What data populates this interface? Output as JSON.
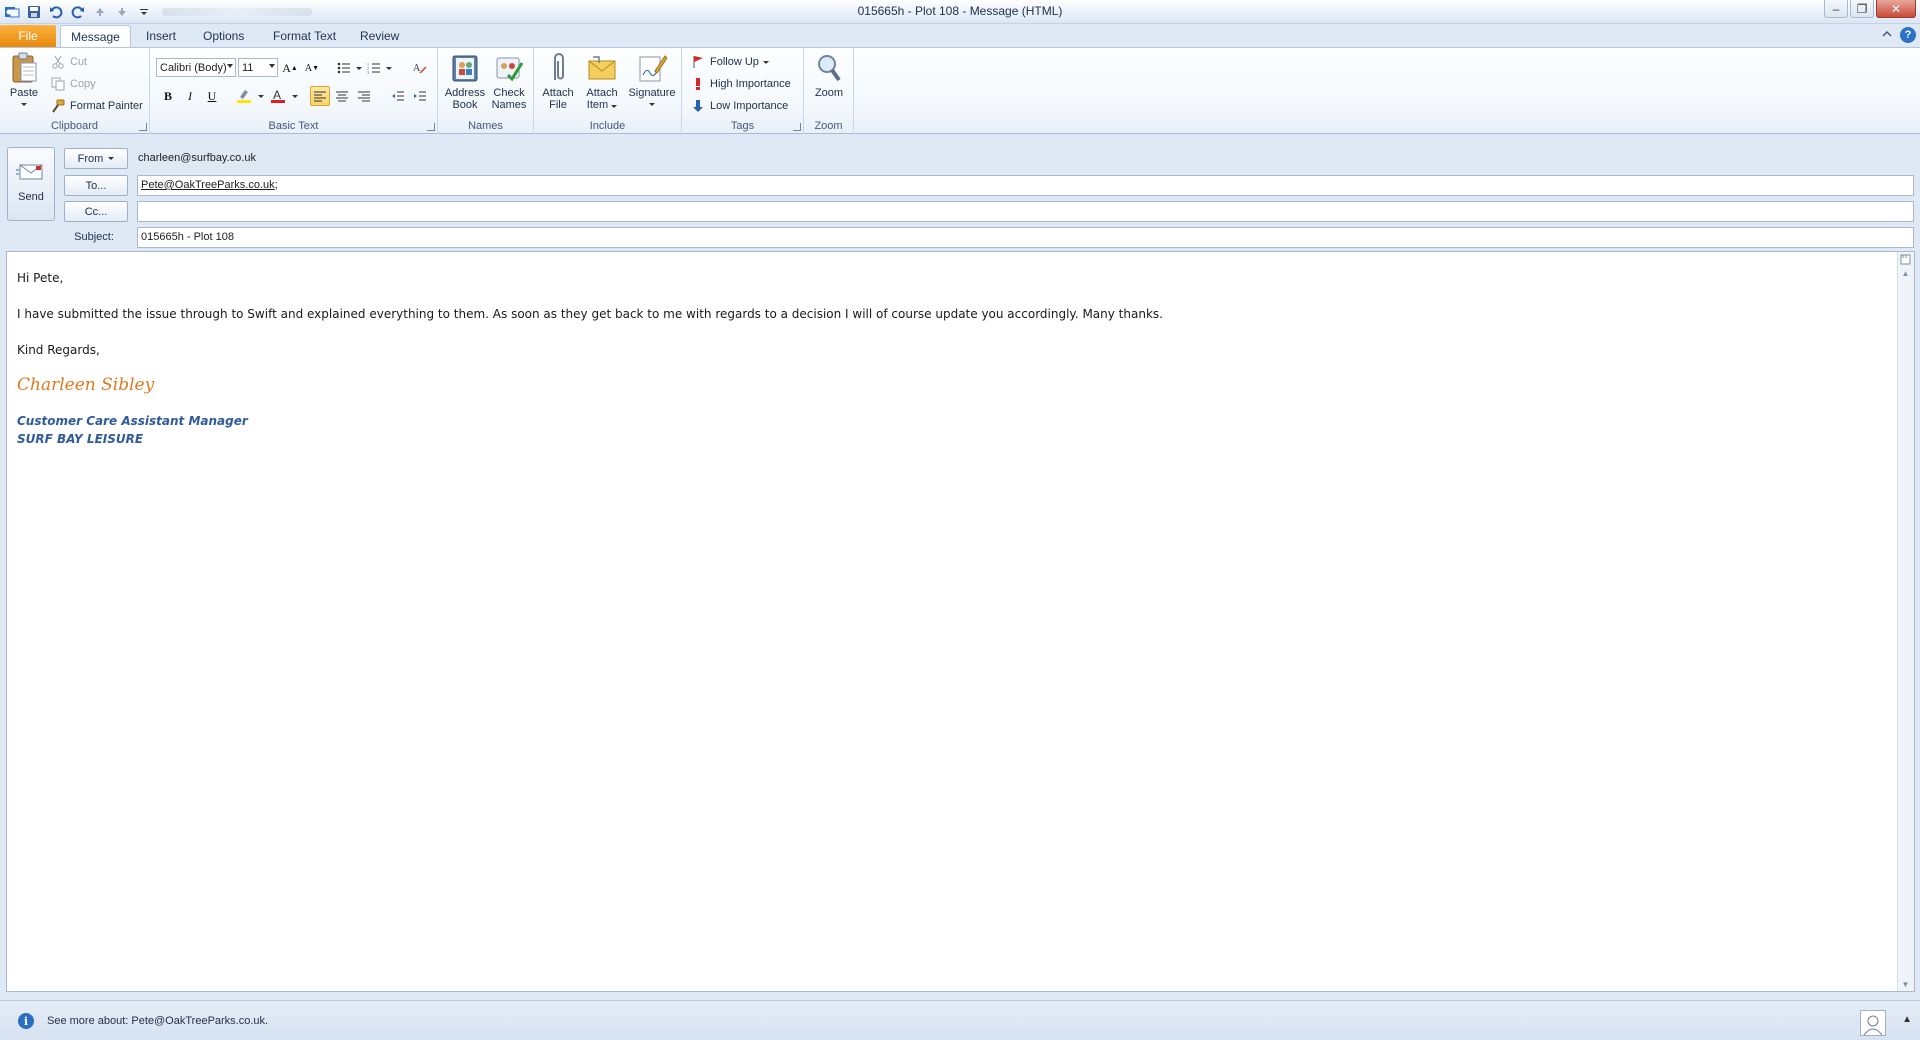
{
  "window": {
    "title": "015665h - Plot 108  -  Message (HTML)",
    "minimize": "–",
    "restore": "❐",
    "close": "✕"
  },
  "tabs": {
    "file": "File",
    "message": "Message",
    "insert": "Insert",
    "options": "Options",
    "format_text": "Format Text",
    "review": "Review"
  },
  "ribbon": {
    "clipboard": {
      "label": "Clipboard",
      "paste": "Paste",
      "cut": "Cut",
      "copy": "Copy",
      "format_painter": "Format Painter"
    },
    "basic_text": {
      "label": "Basic Text",
      "font": "Calibri (Body)",
      "size": "11",
      "bold": "B",
      "italic": "I",
      "underline": "U"
    },
    "names": {
      "label": "Names",
      "address_book_1": "Address",
      "address_book_2": "Book",
      "check_names_1": "Check",
      "check_names_2": "Names"
    },
    "include": {
      "label": "Include",
      "attach_file_1": "Attach",
      "attach_file_2": "File",
      "attach_item_1": "Attach",
      "attach_item_2": "Item",
      "signature": "Signature"
    },
    "tags": {
      "label": "Tags",
      "follow_up": "Follow Up",
      "high_importance": "High Importance",
      "low_importance": "Low Importance"
    },
    "zoom": {
      "label": "Zoom",
      "zoom": "Zoom"
    }
  },
  "header": {
    "send": "Send",
    "from_label": "From",
    "from_value": "charleen@surfbay.co.uk",
    "to_label": "To...",
    "to_value": "Pete@OakTreeParks.co.uk",
    "to_sep": ";",
    "cc_label": "Cc...",
    "cc_value": "",
    "subject_label": "Subject:",
    "subject_value": "015665h - Plot 108"
  },
  "body": {
    "greeting": "Hi Pete,",
    "paragraph": "I have submitted the issue through to Swift and explained everything to them.  As soon as they get back to me with regards to a decision I will of course update you accordingly.  Many thanks.",
    "closing": "Kind Regards,",
    "signature_name": "Charleen Sibley",
    "signature_title": "Customer Care Assistant Manager",
    "signature_company": "SURF BAY LEISURE"
  },
  "status": {
    "text": "See more about: Pete@OakTreeParks.co.uk."
  },
  "colors": {
    "file_tab": "#e98a0d",
    "signature_name": "#e0791e",
    "signature_title": "#2f5b9a",
    "highlight": "#fcd26a"
  }
}
